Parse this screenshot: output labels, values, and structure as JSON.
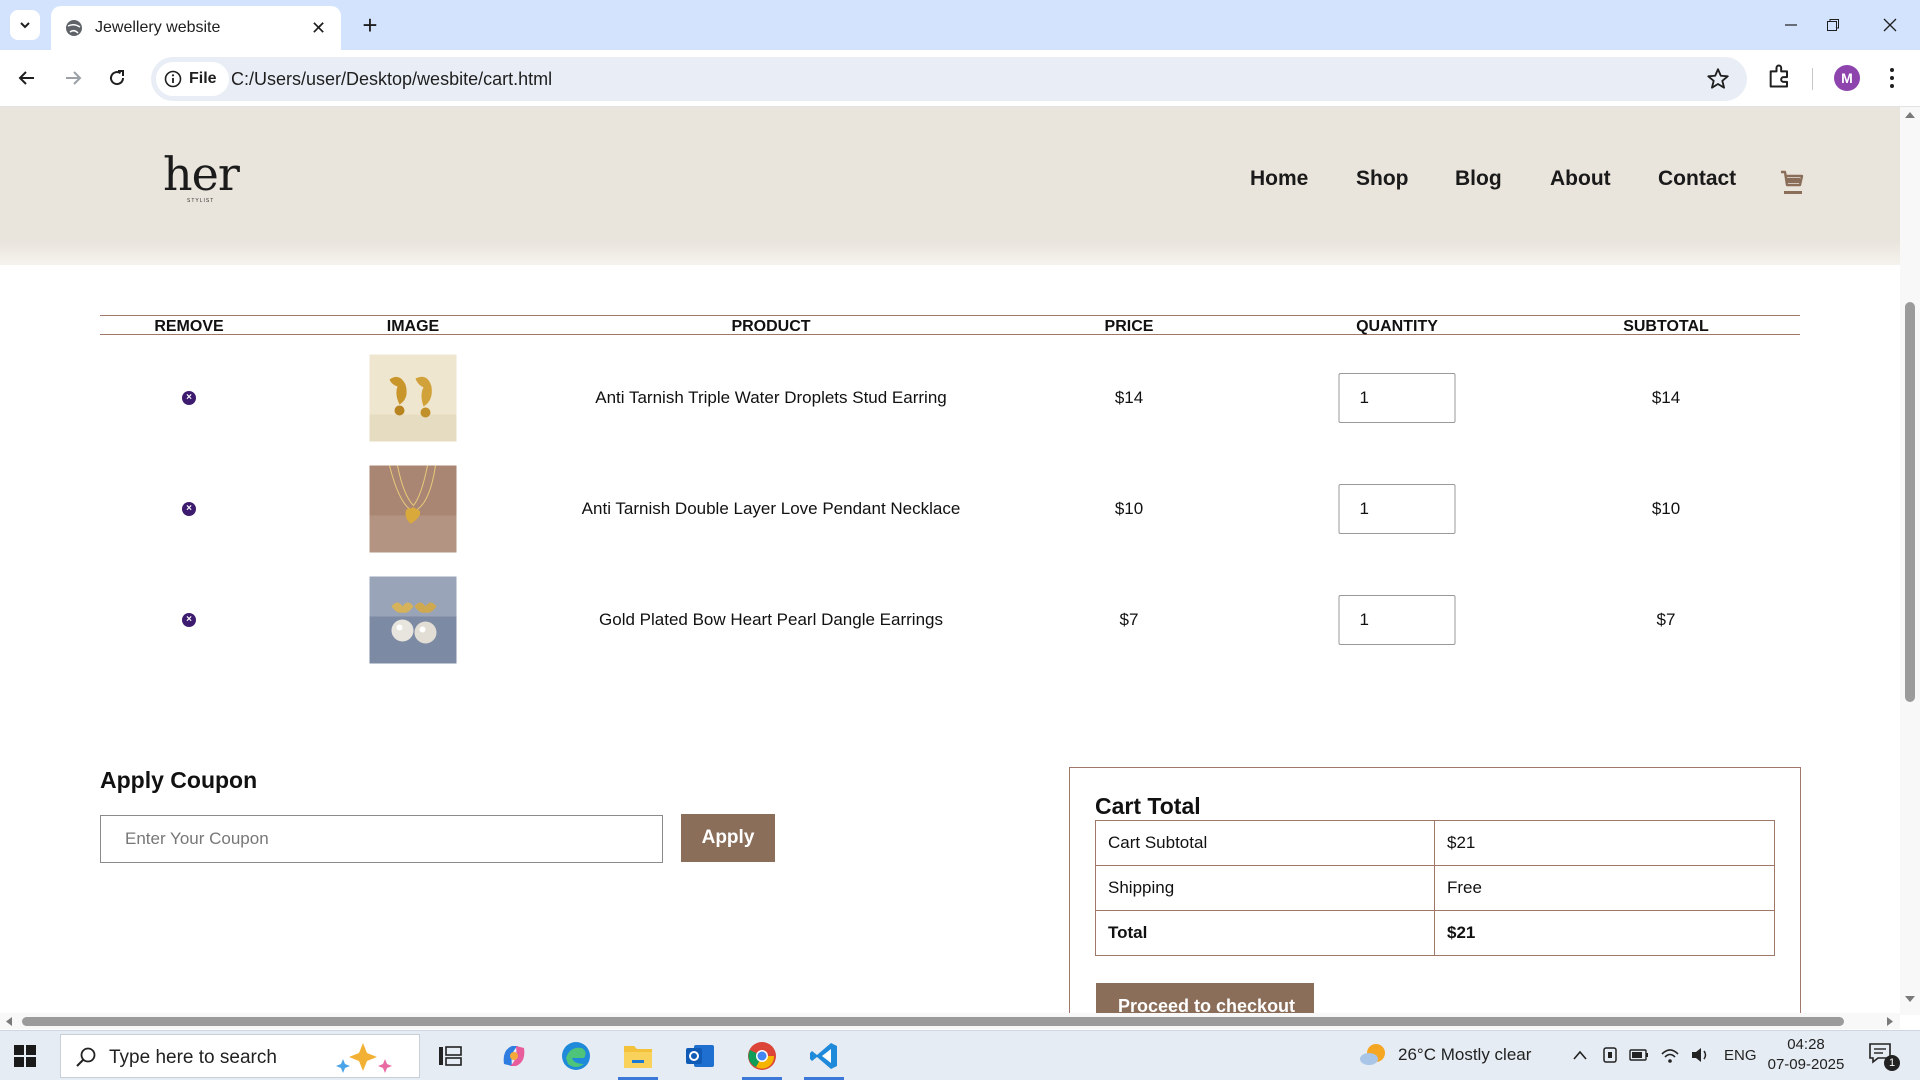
{
  "browser": {
    "tab_title": "Jewellery website",
    "site_info_label": "File",
    "url": "C:/Users/user/Desktop/wesbite/cart.html",
    "profile_initial": "M"
  },
  "site": {
    "logo_text": "her",
    "logo_subtext": "STYLIST",
    "nav": [
      "Home",
      "Shop",
      "Blog",
      "About",
      "Contact"
    ],
    "accent_color": "#8b6e5a"
  },
  "cart": {
    "headers": [
      "REMOVE",
      "IMAGE",
      "PRODUCT",
      "PRICE",
      "QUANTITY",
      "SUBTOTAL"
    ],
    "items": [
      {
        "product": "Anti Tarnish Triple Water Droplets Stud Earring",
        "price": "$14",
        "quantity": "1",
        "subtotal": "$14"
      },
      {
        "product": "Anti Tarnish Double Layer Love Pendant Necklace",
        "price": "$10",
        "quantity": "1",
        "subtotal": "$10"
      },
      {
        "product": "Gold Plated Bow Heart Pearl Dangle Earrings",
        "price": "$7",
        "quantity": "1",
        "subtotal": "$7"
      }
    ]
  },
  "coupon": {
    "title": "Apply Coupon",
    "placeholder": "Enter Your Coupon",
    "button": "Apply"
  },
  "totals": {
    "title": "Cart Total",
    "rows": [
      {
        "label": "Cart Subtotal",
        "value": "$21"
      },
      {
        "label": "Shipping",
        "value": "Free"
      },
      {
        "label": "Total",
        "value": "$21"
      }
    ],
    "checkout_button": "Proceed to checkout"
  },
  "taskbar": {
    "search_placeholder": "Type here to search",
    "weather": "26°C  Mostly clear",
    "language": "ENG",
    "time": "04:28",
    "date": "07-09-2025",
    "notification_count": "1"
  }
}
